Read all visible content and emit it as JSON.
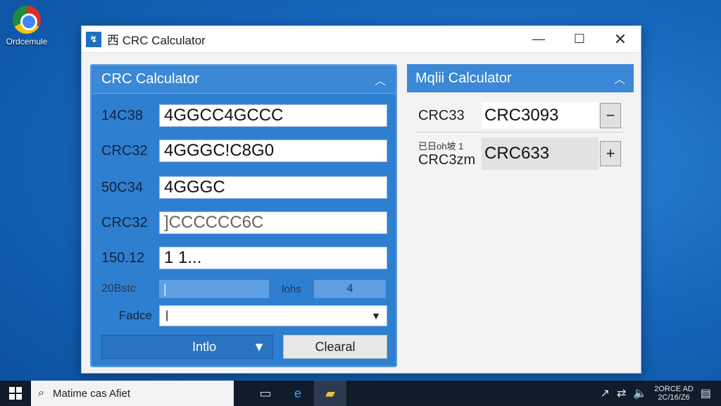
{
  "desktop": {
    "icon_label": "Ordcemule"
  },
  "window": {
    "title": "西 CRC Calculator",
    "minimize": "—",
    "maximize": "☐",
    "close": "✕"
  },
  "left_panel": {
    "header": "CRC Calculator",
    "rows": [
      {
        "label": "14C38",
        "value": "4GGCC4GCCC"
      },
      {
        "label": "CRC32",
        "value": "4GGGC!C8G0"
      },
      {
        "label": "50C34",
        "value": "4GGGC"
      },
      {
        "label": "CRC32",
        "value": "]CCCCCC6C"
      },
      {
        "label": "150.12",
        "value": "1 1..."
      }
    ],
    "split_row": {
      "label": "20Bstc",
      "left_value": "|",
      "mid_label": "lohs",
      "right_value": "4"
    },
    "dropdown": {
      "label": "Fadce",
      "value": "|"
    },
    "info_button": "Intlo",
    "clear_button": "Clearal"
  },
  "right_panel": {
    "header": "Mqlii Calculator",
    "rows": [
      {
        "label": "CRC33",
        "value": "CRC3093",
        "button": "−"
      },
      {
        "sublabel": "已日oh坡 1",
        "label": "CRC3zm",
        "value": "CRC633",
        "button": "+"
      }
    ]
  },
  "taskbar": {
    "search_text": "Matime cas Afiet",
    "clock_time": "2ORCE AD",
    "clock_date": "2C/16/Z6"
  },
  "colors": {
    "accent": "#2f7fd0",
    "header": "#3b88d6",
    "taskbar": "#101b2b"
  }
}
